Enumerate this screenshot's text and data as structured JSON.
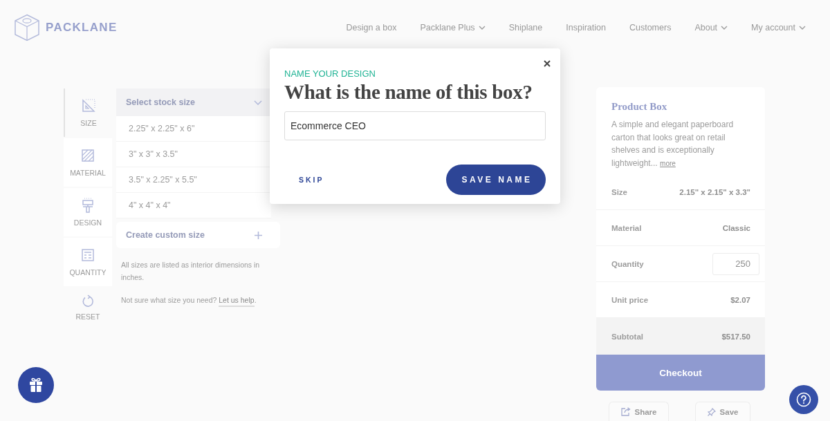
{
  "header": {
    "logo": "PACKLANE",
    "nav": [
      {
        "label": "Design a box",
        "dropdown": false
      },
      {
        "label": "Packlane Plus",
        "dropdown": true
      },
      {
        "label": "Shiplane",
        "dropdown": false
      },
      {
        "label": "Inspiration",
        "dropdown": false
      },
      {
        "label": "Customers",
        "dropdown": false
      },
      {
        "label": "About",
        "dropdown": true
      },
      {
        "label": "My account",
        "dropdown": true
      }
    ]
  },
  "steps": [
    {
      "kind": "size",
      "label": "SIZE",
      "selected": true
    },
    {
      "kind": "material",
      "label": "MATERIAL",
      "selected": false
    },
    {
      "kind": "design",
      "label": "DESIGN",
      "selected": false
    },
    {
      "kind": "quantity",
      "label": "QUANTITY",
      "selected": false
    }
  ],
  "reset": {
    "label": "RESET"
  },
  "size_panel": {
    "select": "Select stock size",
    "options": [
      "2.25\" x 2.25\" x 6\"",
      "3\" x 3\" x 3.5\"",
      "3.5\" x 2.25\" x 5.5\"",
      "4\" x 4\" x 4\""
    ],
    "custom": "Create custom size",
    "note": "All sizes are listed as interior dimensions in inches.",
    "help": {
      "text": "Not sure what size you need?",
      "link": "Let us help",
      "after_link": "."
    }
  },
  "summary": {
    "title": "Product Box",
    "description": "A simple and elegant paperboard carton that looks great on retail shelves and is exceptionally lightweight...",
    "more": "more",
    "rows": [
      {
        "kind": "text",
        "label": "Size",
        "value": "2.15\" x 2.15\" x 3.3\""
      },
      {
        "kind": "text",
        "label": "Material",
        "value": "Classic"
      },
      {
        "kind": "input",
        "label": "Quantity",
        "value": "250"
      },
      {
        "kind": "text",
        "label": "Unit price",
        "value": "$2.07"
      },
      {
        "kind": "total",
        "label": "Subtotal",
        "value": "$517.50"
      }
    ],
    "checkout": "Checkout",
    "actions": [
      {
        "kind": "share",
        "label": "Share"
      },
      {
        "kind": "save",
        "label": "Save"
      }
    ]
  },
  "modal": {
    "eyebrow": "NAME YOUR DESIGN",
    "title": "What is the name of this box?",
    "value": "Ecommerce CEO",
    "skip": "SKIP",
    "save": "SAVE NAME"
  }
}
